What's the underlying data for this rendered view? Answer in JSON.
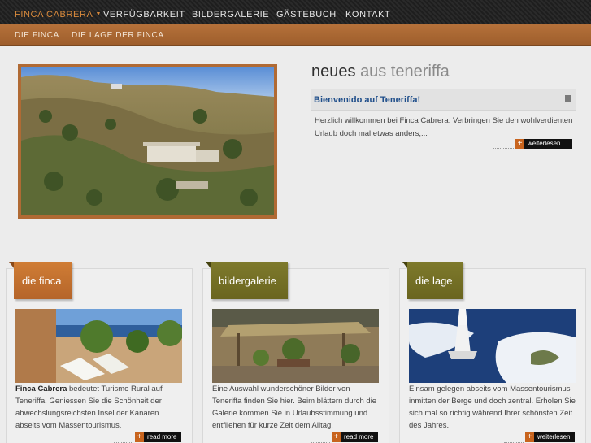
{
  "topnav": {
    "items": [
      {
        "label": "Finca Cabrera",
        "active": true
      },
      {
        "label": "Verfügbarkeit"
      },
      {
        "label": "Bildergalerie"
      },
      {
        "label": "Gästebuch"
      },
      {
        "label": "Kontakt"
      }
    ],
    "caret": "▼"
  },
  "subnav": {
    "items": [
      {
        "label": "Die Finca"
      },
      {
        "label": "Die Lage der Finca"
      }
    ]
  },
  "news": {
    "title_main": "neues",
    "title_rest": "aus teneriffa",
    "headline": "Bienvenido auf Teneriffa!",
    "text": "Herzlich willkommen bei Finca Cabrera. Verbringen Sie den wohlverdienten Urlaub doch mal etwas anders,...",
    "more_label": "weiterlesen ..."
  },
  "cards": [
    {
      "tab": "die finca",
      "text_bold": "Finca Cabrera",
      "text": " bedeutet Turismo Rural auf Teneriffa. Geniessen Sie die Schönheit der abwechslungsreichsten Insel der Kanaren abseits vom Massentourismus.",
      "more_label": "read more"
    },
    {
      "tab": "bildergalerie",
      "text": "Eine Auswahl wunderschöner Bilder von Teneriffa finden Sie hier. Beim blättern durch die Galerie kommen Sie in Urlaubsstimmung und entfliehen für kurze Zeit dem Alltag.",
      "more_label": "read more"
    },
    {
      "tab": "die lage",
      "text": "Einsam gelegen abseits vom Massentourismus inmitten der Berge und doch zentral. Erholen Sie sich mal so richtig während Ihrer schönsten Zeit des Jahres.",
      "more_label": "weiterlesen"
    }
  ],
  "icons": {
    "plus": "+"
  },
  "colors": {
    "accent_orange": "#c8641e",
    "subnav_brown": "#a8652f",
    "tab_olive": "#7e7a2c",
    "headline_blue": "#1f4e8a"
  }
}
